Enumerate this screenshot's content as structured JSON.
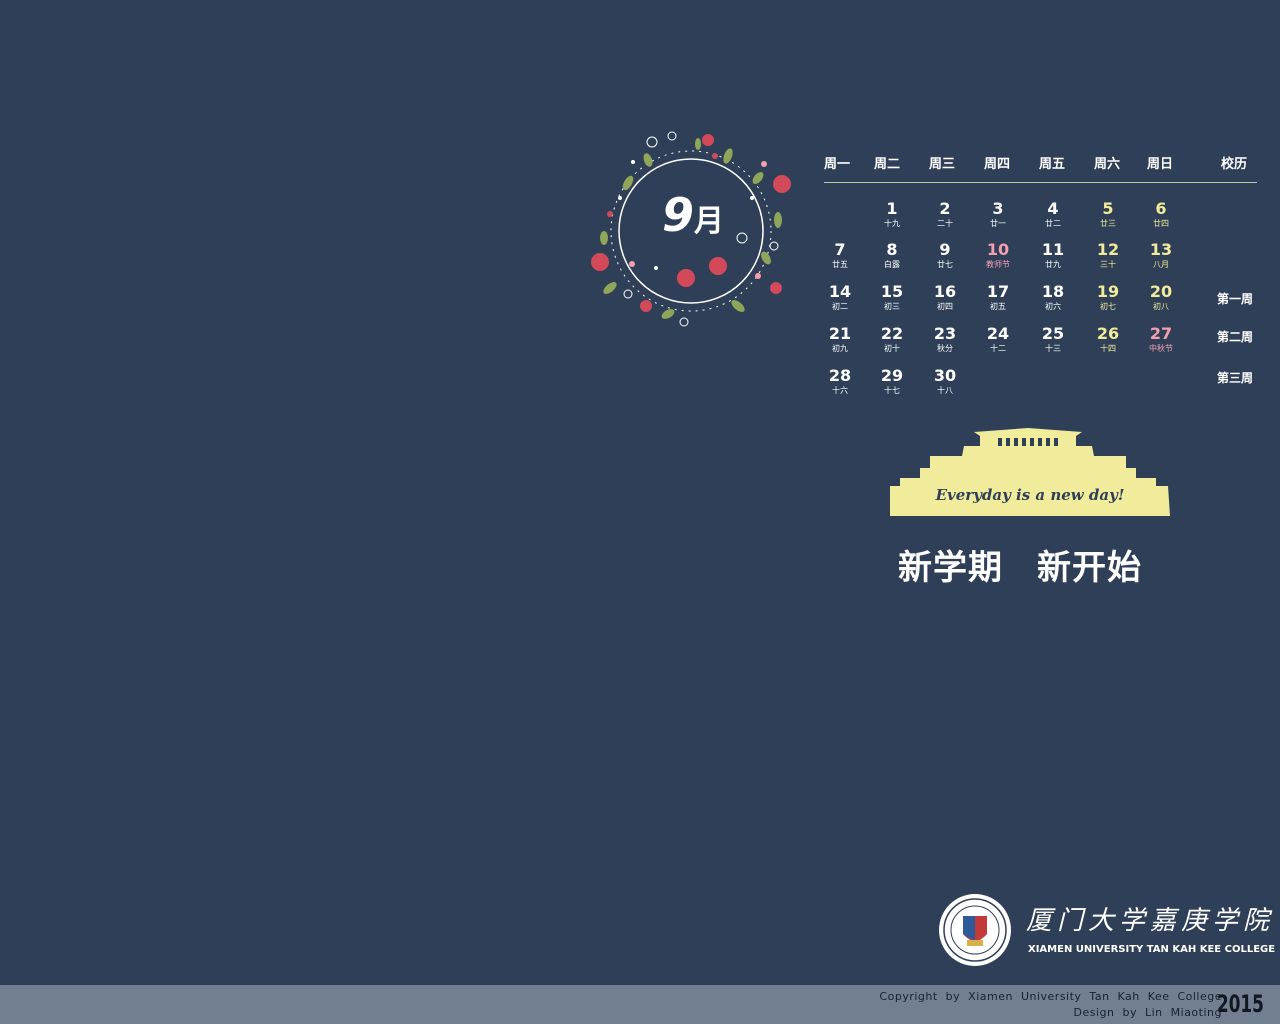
{
  "month": {
    "number": "9",
    "unit": "月"
  },
  "weekday_headers": [
    "周一",
    "周二",
    "周三",
    "周四",
    "周五",
    "周六",
    "周日"
  ],
  "school_calendar_header": "校历",
  "weeks": [
    [
      null,
      {
        "d": "1",
        "l": "十九",
        "t": "wk"
      },
      {
        "d": "2",
        "l": "二十",
        "t": "wk"
      },
      {
        "d": "3",
        "l": "廿一",
        "t": "wk"
      },
      {
        "d": "4",
        "l": "廿二",
        "t": "wk"
      },
      {
        "d": "5",
        "l": "廿三",
        "t": "we"
      },
      {
        "d": "6",
        "l": "廿四",
        "t": "we"
      }
    ],
    [
      {
        "d": "7",
        "l": "廿五",
        "t": "wk"
      },
      {
        "d": "8",
        "l": "白露",
        "t": "wk"
      },
      {
        "d": "9",
        "l": "廿七",
        "t": "wk"
      },
      {
        "d": "10",
        "l": "教师节",
        "t": "hol"
      },
      {
        "d": "11",
        "l": "廿九",
        "t": "wk"
      },
      {
        "d": "12",
        "l": "三十",
        "t": "we"
      },
      {
        "d": "13",
        "l": "八月",
        "t": "we"
      }
    ],
    [
      {
        "d": "14",
        "l": "初二",
        "t": "wk"
      },
      {
        "d": "15",
        "l": "初三",
        "t": "wk"
      },
      {
        "d": "16",
        "l": "初四",
        "t": "wk"
      },
      {
        "d": "17",
        "l": "初五",
        "t": "wk"
      },
      {
        "d": "18",
        "l": "初六",
        "t": "wk"
      },
      {
        "d": "19",
        "l": "初七",
        "t": "we"
      },
      {
        "d": "20",
        "l": "初八",
        "t": "we"
      }
    ],
    [
      {
        "d": "21",
        "l": "初九",
        "t": "wk"
      },
      {
        "d": "22",
        "l": "初十",
        "t": "wk"
      },
      {
        "d": "23",
        "l": "秋分",
        "t": "wk"
      },
      {
        "d": "24",
        "l": "十二",
        "t": "wk"
      },
      {
        "d": "25",
        "l": "十三",
        "t": "wk"
      },
      {
        "d": "26",
        "l": "十四",
        "t": "we"
      },
      {
        "d": "27",
        "l": "中秋节",
        "t": "hol"
      }
    ],
    [
      {
        "d": "28",
        "l": "十六",
        "t": "wk"
      },
      {
        "d": "29",
        "l": "十七",
        "t": "wk"
      },
      {
        "d": "30",
        "l": "十八",
        "t": "wk"
      },
      null,
      null,
      null,
      null
    ]
  ],
  "school_weeks": [
    "",
    "",
    "第一周",
    "第二周",
    "第三周"
  ],
  "motto": "Everyday is a new day!",
  "slogan": [
    "新学期",
    "新开始"
  ],
  "logo": {
    "chinese": "厦门大学嘉庚学院",
    "english": "XIAMEN UNIVERSITY TAN KAH KEE COLLEGE"
  },
  "footer": {
    "copyright": "Copyright by Xiamen University Tan Kah Kee College",
    "design": "Design by Lin Miaoting",
    "year": "2015"
  },
  "colors": {
    "background": "#2e3f57",
    "weekend": "#f1ec9c",
    "holiday": "#f2a0b0",
    "building": "#f1ec9c",
    "footer": "#717f90"
  }
}
